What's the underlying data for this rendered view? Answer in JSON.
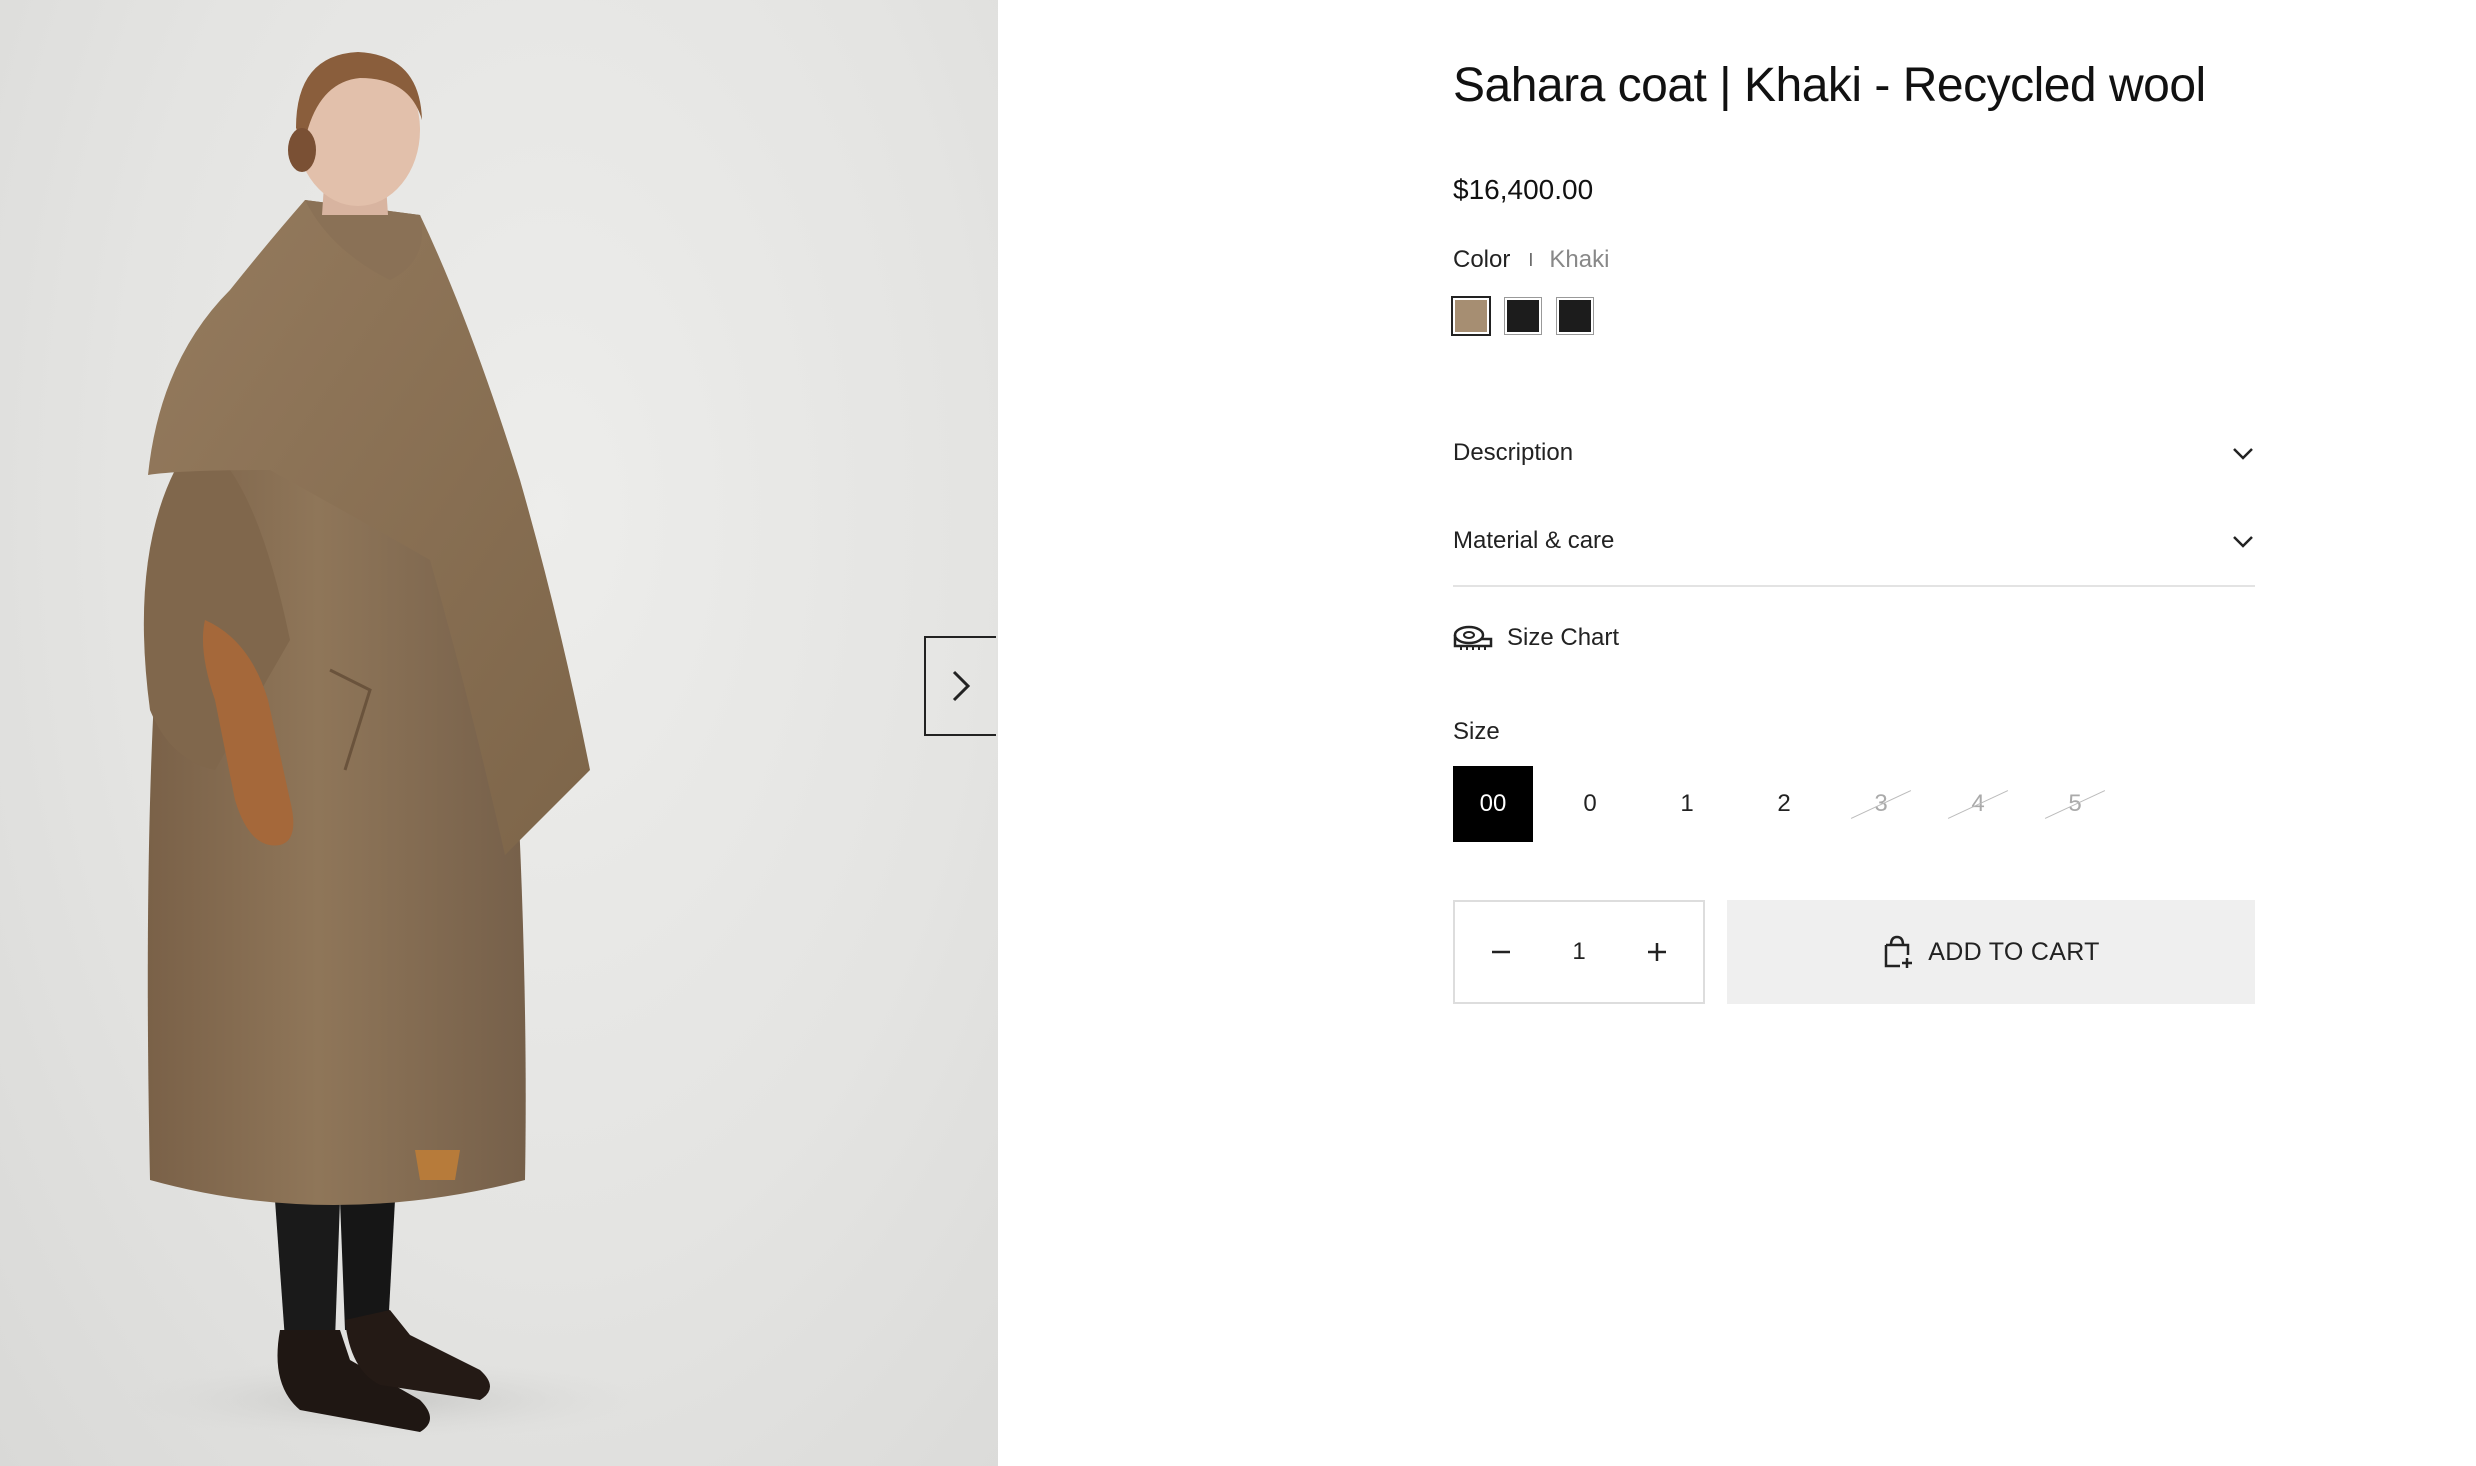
{
  "product": {
    "title": "Sahara coat | Khaki - Recycled wool",
    "price": "$16,400.00"
  },
  "color": {
    "label": "Color",
    "separator": "I",
    "selected": "Khaki",
    "swatches": [
      {
        "name": "Khaki",
        "hex": "#a68e72"
      },
      {
        "name": "Black",
        "hex": "#1c1c1c"
      },
      {
        "name": "Black",
        "hex": "#1c1c1c"
      }
    ]
  },
  "accordions": {
    "description": "Description",
    "material": "Material & care"
  },
  "size_chart": {
    "label": "Size Chart",
    "icon": "measuring-tape-icon"
  },
  "size": {
    "label": "Size",
    "options": [
      {
        "label": "00",
        "state": "selected"
      },
      {
        "label": "0",
        "state": "available"
      },
      {
        "label": "1",
        "state": "available"
      },
      {
        "label": "2",
        "state": "available"
      },
      {
        "label": "3",
        "state": "soldout"
      },
      {
        "label": "4",
        "state": "soldout"
      },
      {
        "label": "5",
        "state": "soldout"
      }
    ]
  },
  "quantity": {
    "value": "1",
    "minus_icon": "minus-icon",
    "plus_icon": "plus-icon"
  },
  "cart": {
    "label": "ADD TO CART",
    "icon": "shopping-bag-add-icon"
  },
  "gallery": {
    "next_icon": "chevron-right-icon",
    "image": "model wearing khaki wrap coat"
  },
  "colors": {
    "coat": "#8c7358",
    "background": "#e6e6e4",
    "selected_size": "#000000",
    "cart_bg": "#efefef"
  }
}
